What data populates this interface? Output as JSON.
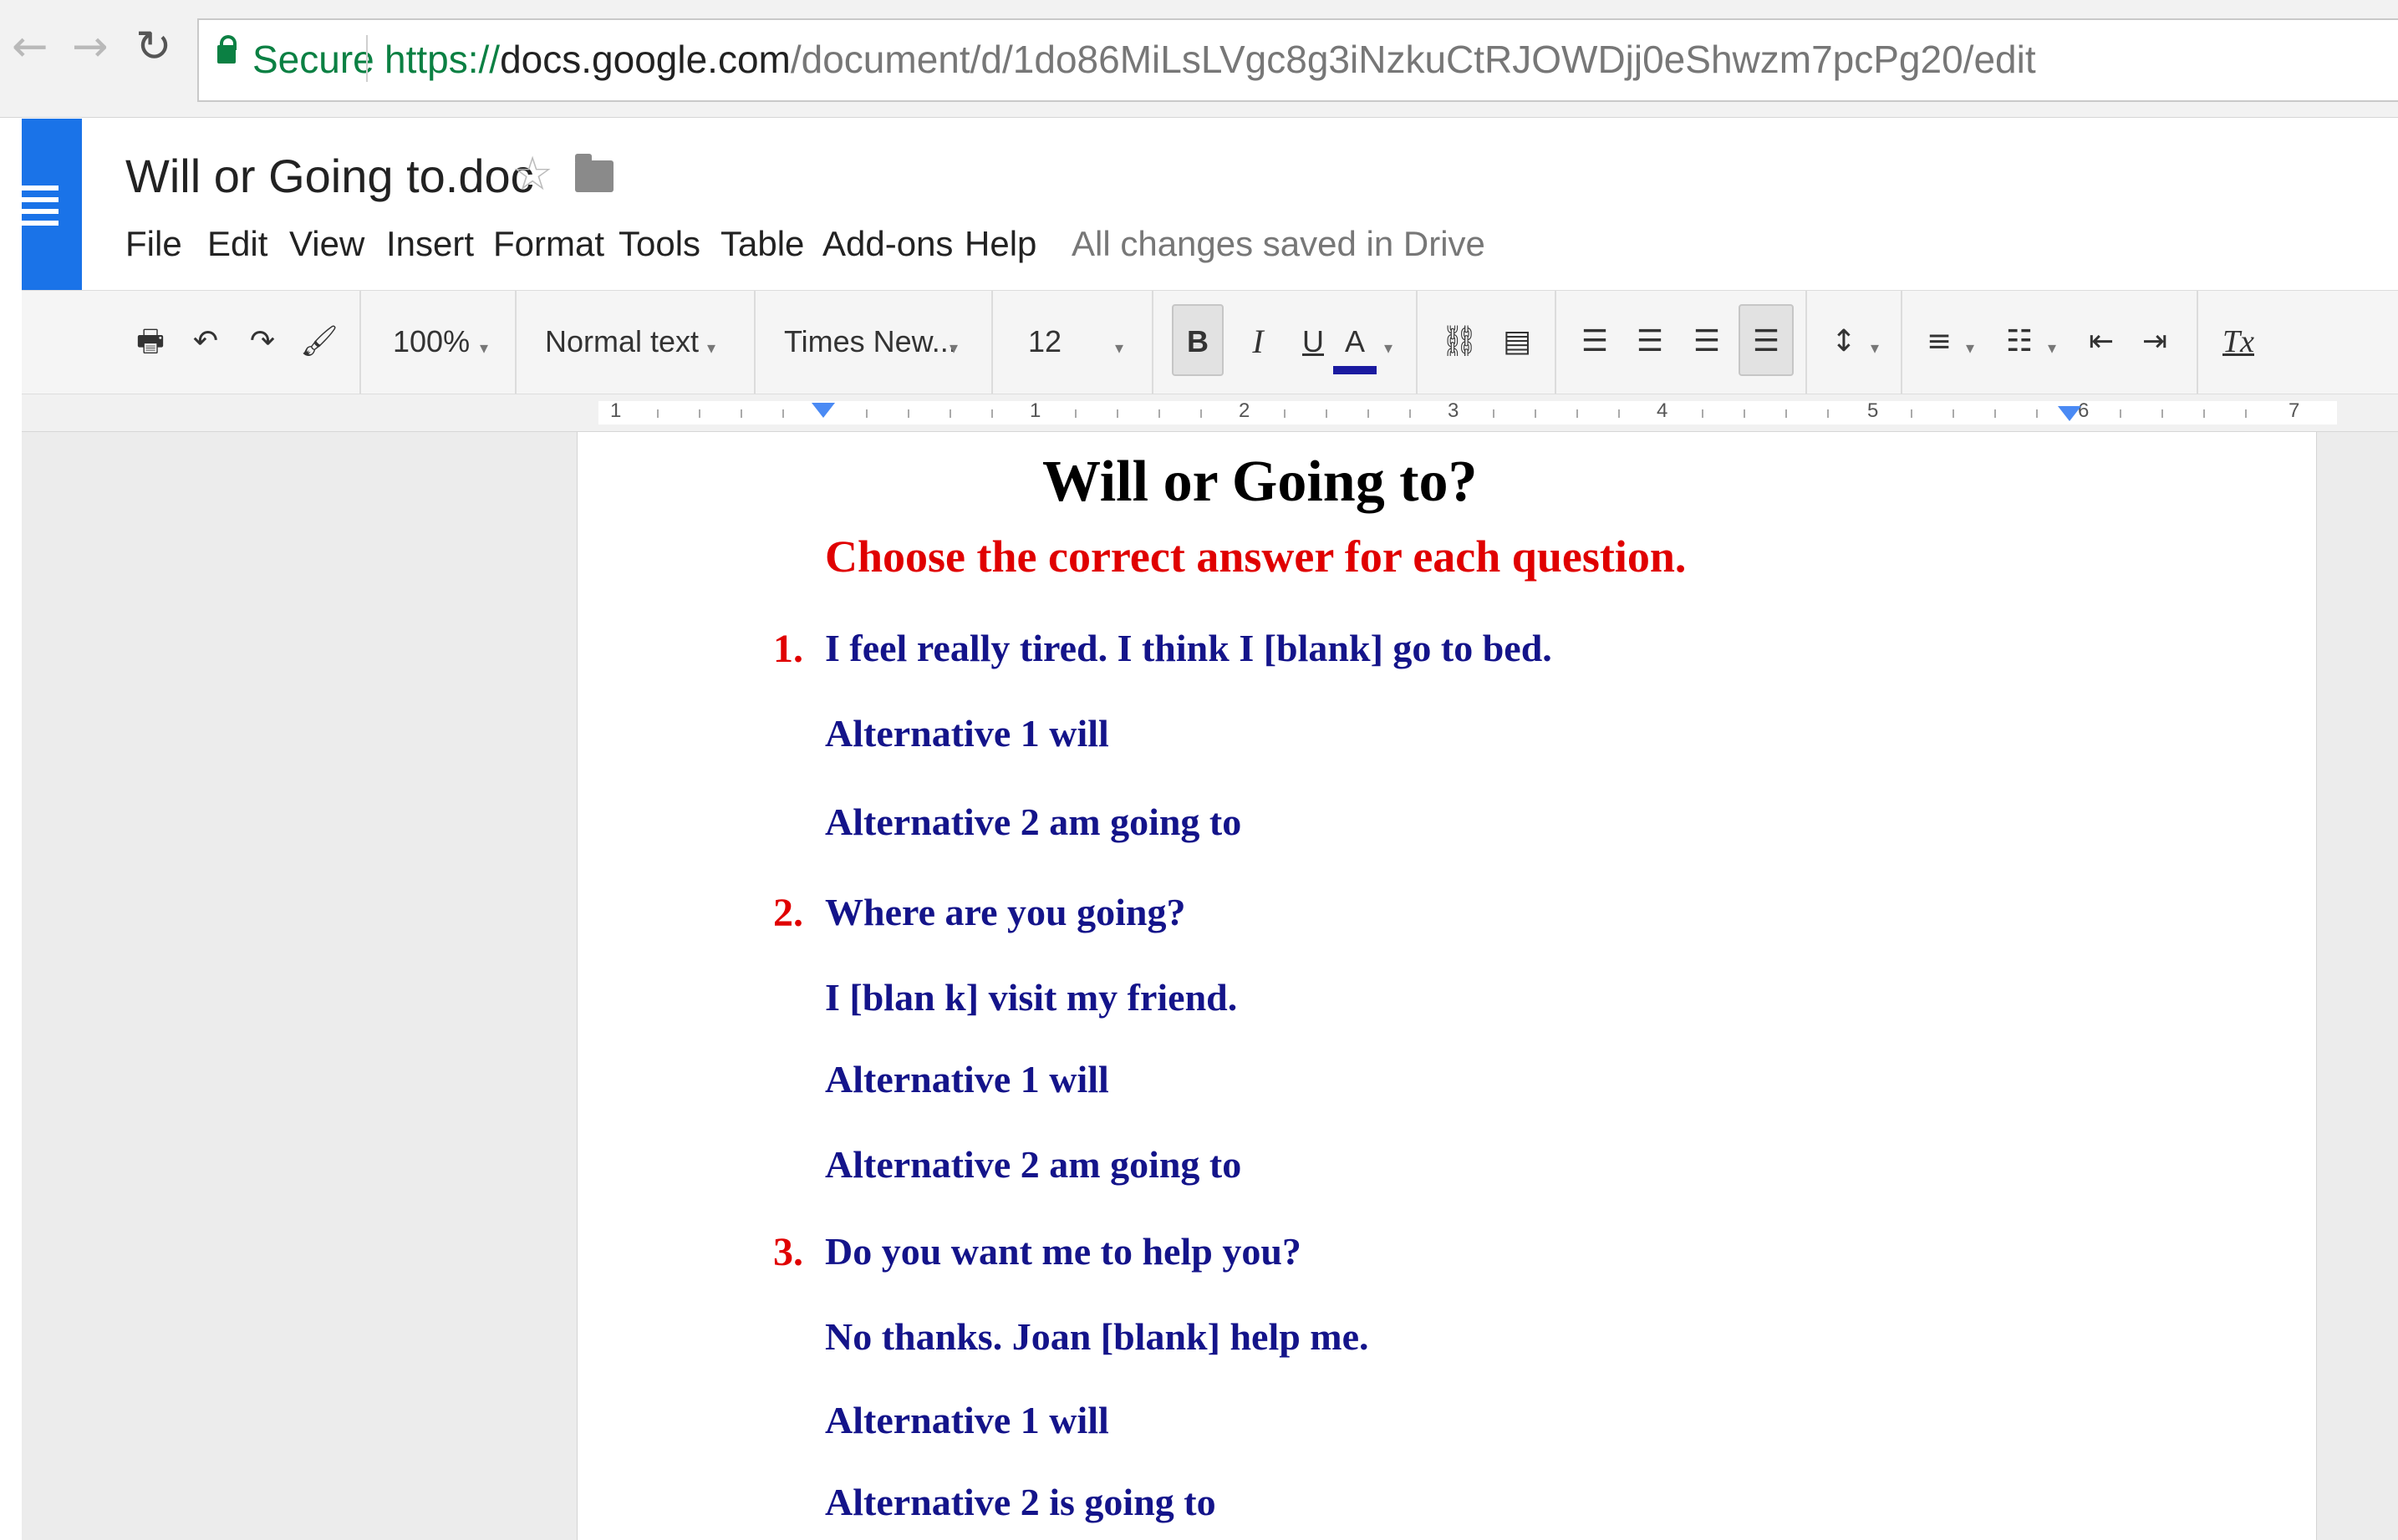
{
  "browser": {
    "back_icon": "arrow-left-icon",
    "forward_icon": "arrow-right-icon",
    "reload_icon": "reload-icon",
    "security_label": "Secure",
    "url_scheme": "https://",
    "url_host": "docs.google.com",
    "url_path": "/document/d/1do86MiLsLVgc8g3iNzkuCtRJOWDjj0eShwzm7pcPg20/edit"
  },
  "header": {
    "title": "Will or Going to.doc",
    "star_icon": "star-icon",
    "folder_icon": "folder-icon",
    "status": "All changes saved in Drive"
  },
  "menu": [
    "File",
    "Edit",
    "View",
    "Insert",
    "Format",
    "Tools",
    "Table",
    "Add-ons",
    "Help"
  ],
  "toolbar": {
    "zoom": "100%",
    "style": "Normal text",
    "font": "Times New...",
    "size": "12",
    "bold": "B",
    "italic": "I",
    "underline": "U",
    "text_color": "A",
    "clear_formatting": "Tx",
    "text_color_hex": "#1a1aa0"
  },
  "ruler": {
    "numbers": [
      "1",
      "1",
      "2",
      "3",
      "4",
      "5",
      "6",
      "7"
    ]
  },
  "document": {
    "title": "Will or Going to?",
    "instruction": "Choose the correct answer for each question.",
    "questions": [
      {
        "number": "1.",
        "text": "I feel really tired. I think I [blank] go to bed.",
        "lines": [
          "Alternative 1 will",
          "Alternative 2  am going to"
        ]
      },
      {
        "number": "2.",
        "text": "Where  are you going?",
        "lines": [
          "I [blan k] visit my friend.",
          "Alternative 1 will",
          "Alternative 2 am going to"
        ]
      },
      {
        "number": "3.",
        "text": "Do you want me to help you?",
        "lines": [
          "No thanks. Joan [blank]  help me.",
          "Alternative 1 will",
          "Alternative 2 is going to"
        ]
      }
    ]
  },
  "colors": {
    "docs_blue": "#1a73e8",
    "secure_green": "#0b8043",
    "heading_red": "#e00000",
    "body_navy": "#14148a"
  }
}
